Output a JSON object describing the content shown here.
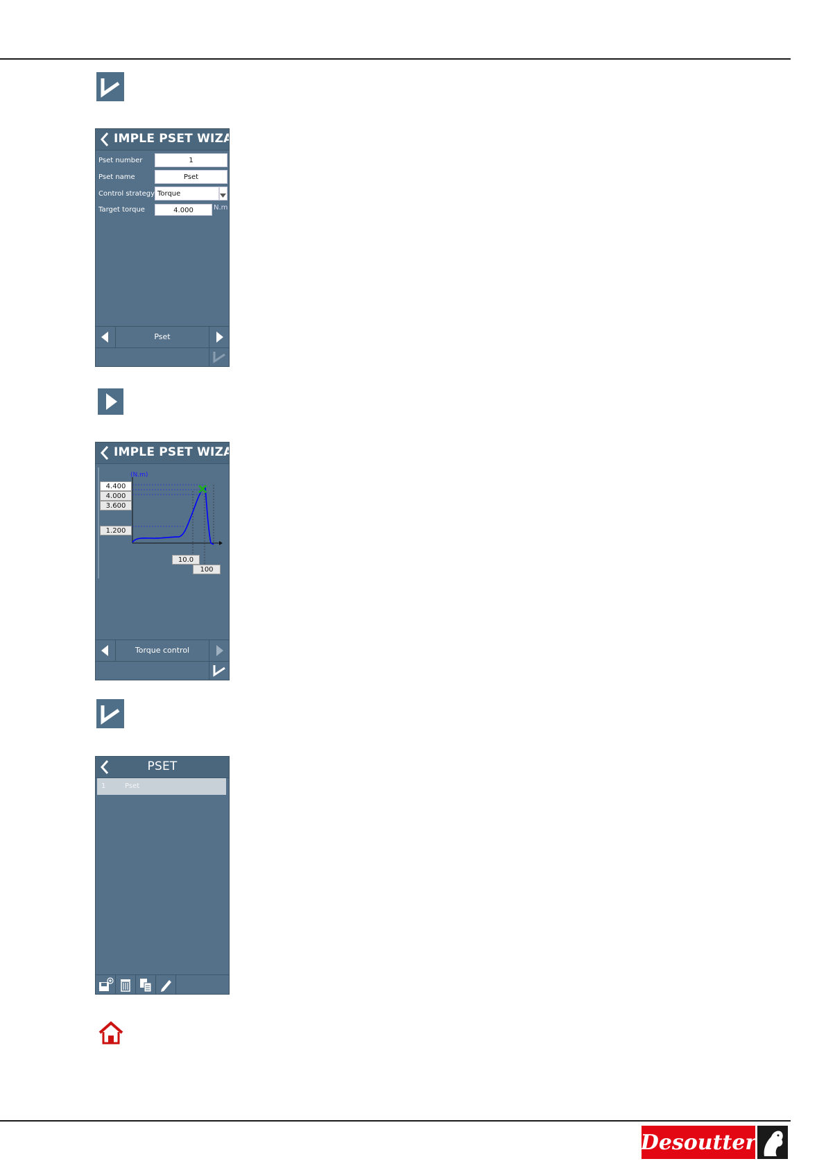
{
  "panel1": {
    "title": "IMPLE PSET WIZARD",
    "fields": [
      {
        "label": "Pset number",
        "value": "1"
      },
      {
        "label": "Pset name",
        "value": "Pset"
      },
      {
        "label": "Control strategy",
        "value": "Torque"
      },
      {
        "label": "Target torque",
        "value": "4.000",
        "unit": "N.m"
      }
    ],
    "nav_label": "Pset"
  },
  "panel2": {
    "title": "IMPLE PSET WIZARD",
    "y_unit": "(N.m)",
    "y_ticks": [
      "4.400",
      "4.000",
      "3.600",
      "1.200"
    ],
    "x_ticks": [
      "10.0",
      "100"
    ],
    "nav_label": "Torque control"
  },
  "panel3": {
    "title": "PSET",
    "rows": [
      {
        "number": "1",
        "name": "Pset"
      }
    ]
  },
  "colors": {
    "panel_bg": "#557189",
    "icon_bg": "#4f6f88",
    "curve": "#0000ff",
    "target_marker": "#22aa22",
    "home_red": "#cc1111",
    "brand_red": "#e30613"
  },
  "icons": [
    "validate-icon",
    "next-arrow-icon",
    "validate-icon",
    "home-icon"
  ],
  "logo": {
    "text": "Desoutter"
  }
}
